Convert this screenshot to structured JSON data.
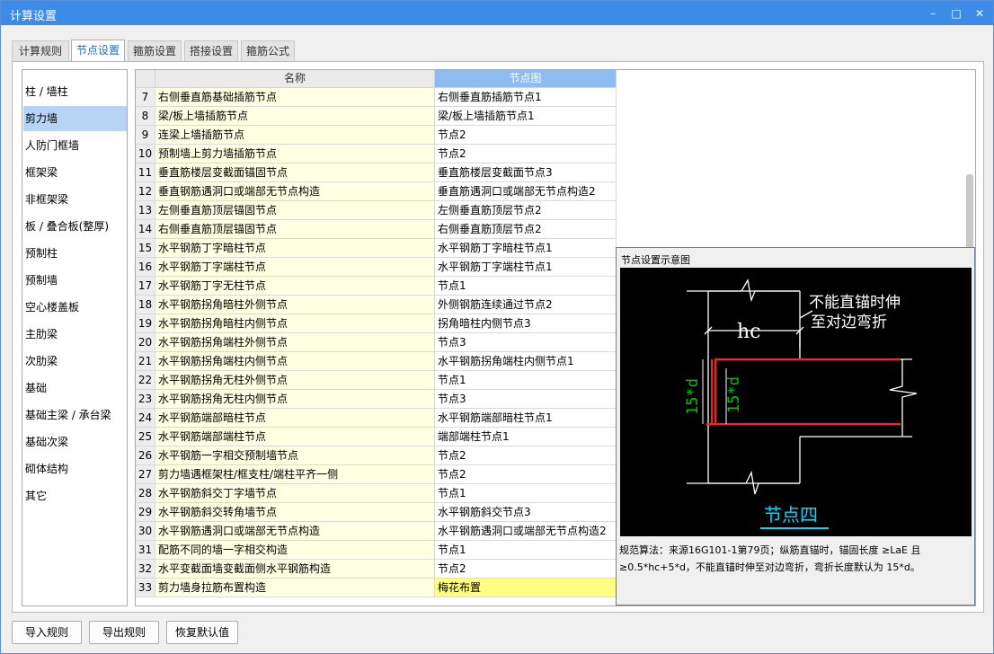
{
  "window": {
    "title": "计算设置",
    "min": "–",
    "max": "□",
    "close": "✕"
  },
  "tabs": [
    "计算规则",
    "节点设置",
    "箍筋设置",
    "搭接设置",
    "箍筋公式"
  ],
  "categories": [
    "柱 / 墙柱",
    "剪力墙",
    "人防门框墙",
    "框架梁",
    "非框架梁",
    "板 / 叠合板(整厚)",
    "预制柱",
    "预制墙",
    "空心楼盖板",
    "主肋梁",
    "次肋梁",
    "基础",
    "基础主梁 / 承台梁",
    "基础次梁",
    "砌体结构",
    "其它"
  ],
  "selected_category": "剪力墙",
  "grid": {
    "col_name": "名称",
    "col_node": "节点图",
    "rows": [
      {
        "num": "7",
        "name": "右侧垂直筋基础插筋节点",
        "node": "右侧垂直筋插筋节点1"
      },
      {
        "num": "8",
        "name": "梁/板上墙插筋节点",
        "node": "梁/板上墙插筋节点1"
      },
      {
        "num": "9",
        "name": "连梁上墙插筋节点",
        "node": "节点2"
      },
      {
        "num": "10",
        "name": "预制墙上剪力墙插筋节点",
        "node": "节点2"
      },
      {
        "num": "11",
        "name": "垂直筋楼层变截面锚固节点",
        "node": "垂直筋楼层变截面节点3"
      },
      {
        "num": "12",
        "name": "垂直钢筋遇洞口或端部无节点构造",
        "node": "垂直筋遇洞口或端部无节点构造2"
      },
      {
        "num": "13",
        "name": "左侧垂直筋顶层锚固节点",
        "node": "左侧垂直筋顶层节点2"
      },
      {
        "num": "14",
        "name": "右侧垂直筋顶层锚固节点",
        "node": "右侧垂直筋顶层节点2"
      },
      {
        "num": "15",
        "name": "水平钢筋丁字暗柱节点",
        "node": "水平钢筋丁字暗柱节点1"
      },
      {
        "num": "16",
        "name": "水平钢筋丁字端柱节点",
        "node": "水平钢筋丁字端柱节点1"
      },
      {
        "num": "17",
        "name": "水平钢筋丁字无柱节点",
        "node": "节点1"
      },
      {
        "num": "18",
        "name": "水平钢筋拐角暗柱外侧节点",
        "node": "外侧钢筋连续通过节点2"
      },
      {
        "num": "19",
        "name": "水平钢筋拐角暗柱内侧节点",
        "node": "拐角暗柱内侧节点3"
      },
      {
        "num": "20",
        "name": "水平钢筋拐角端柱外侧节点",
        "node": "节点3"
      },
      {
        "num": "21",
        "name": "水平钢筋拐角端柱内侧节点",
        "node": "水平钢筋拐角端柱内侧节点1"
      },
      {
        "num": "22",
        "name": "水平钢筋拐角无柱外侧节点",
        "node": "节点1"
      },
      {
        "num": "23",
        "name": "水平钢筋拐角无柱内侧节点",
        "node": "节点3"
      },
      {
        "num": "24",
        "name": "水平钢筋端部暗柱节点",
        "node": "水平钢筋端部暗柱节点1"
      },
      {
        "num": "25",
        "name": "水平钢筋端部端柱节点",
        "node": "端部端柱节点1"
      },
      {
        "num": "26",
        "name": "水平钢筋一字相交预制墙节点",
        "node": "节点2"
      },
      {
        "num": "27",
        "name": "剪力墙遇框架柱/框支柱/端柱平齐一侧",
        "node": "节点2"
      },
      {
        "num": "28",
        "name": "水平钢筋斜交丁字墙节点",
        "node": "节点1"
      },
      {
        "num": "29",
        "name": "水平钢筋斜交转角墙节点",
        "node": "水平钢筋斜交节点3"
      },
      {
        "num": "30",
        "name": "水平钢筋遇洞口或端部无节点构造",
        "node": "水平钢筋遇洞口或端部无节点构造2"
      },
      {
        "num": "31",
        "name": "配筋不同的墙一字相交构造",
        "node": "节点1"
      },
      {
        "num": "32",
        "name": "水平变截面墙变截面侧水平钢筋构造",
        "node": "节点2"
      },
      {
        "num": "33",
        "name": "剪力墙身拉筋布置构造",
        "node": "梅花布置"
      }
    ]
  },
  "diagram": {
    "title": "节点设置示意图",
    "label_anchor": "不能直锚时伸",
    "label_anchor2": "至对边弯折",
    "label_hc": "hc",
    "label_15d_outer": "15*d",
    "label_15d_inner": "15*d",
    "caption": "节点四",
    "description": "规范算法：来源16G101-1第79页；纵筋直锚时，锚固长度 ≥LaE 且≥0.5*hc+5*d，不能直锚时伸至对边弯折，弯折长度默认为 15*d。",
    "colors": {
      "bg": "#000000",
      "rebar": "#ff2020",
      "dim": "#00c000",
      "caption": "#00d8ff",
      "line": "#ffffff"
    }
  },
  "buttons": {
    "import": "导入规则",
    "export": "导出规则",
    "restore": "恢复默认值"
  }
}
